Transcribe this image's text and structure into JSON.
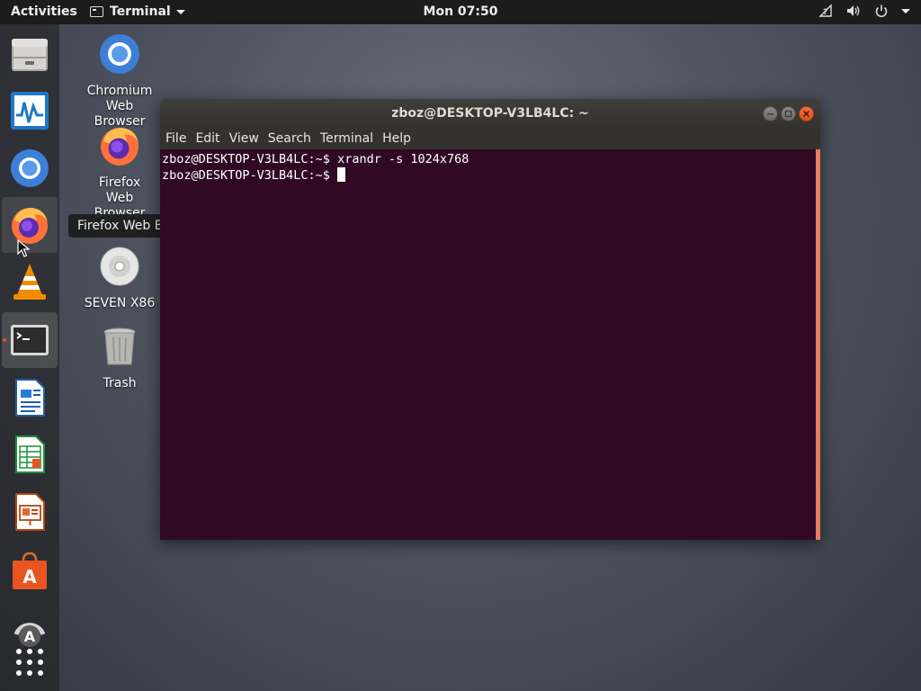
{
  "topbar": {
    "activities": "Activities",
    "app_menu": "Terminal",
    "clock": "Mon 07:50"
  },
  "dock": {
    "items": [
      {
        "name": "Files"
      },
      {
        "name": "System Monitor"
      },
      {
        "name": "Chromium Web Browser"
      },
      {
        "name": "Firefox Web Browser"
      },
      {
        "name": "VLC media player"
      },
      {
        "name": "Terminal",
        "running": true
      },
      {
        "name": "LibreOffice Writer"
      },
      {
        "name": "LibreOffice Calc"
      },
      {
        "name": "LibreOffice Impress"
      },
      {
        "name": "Ubuntu Software"
      },
      {
        "name": "Software Updater"
      },
      {
        "name": "Show Applications"
      }
    ]
  },
  "desktop": {
    "icons": [
      {
        "label": "Chromium\nWeb\nBrowser"
      },
      {
        "label": "Firefox\nWeb\nBrowser"
      },
      {
        "label": "SEVEN X86"
      },
      {
        "label": "Trash"
      }
    ]
  },
  "tooltip": "Firefox Web Browser",
  "terminal": {
    "title": "zboz@DESKTOP-V3LB4LC: ~",
    "menu": [
      "File",
      "Edit",
      "View",
      "Search",
      "Terminal",
      "Help"
    ],
    "lines": [
      "zboz@DESKTOP-V3LB4LC:~$ xrandr -s 1024x768",
      "zboz@DESKTOP-V3LB4LC:~$ "
    ],
    "background": "#300a24"
  },
  "colors": {
    "accent": "#e95420",
    "topbar": "#1c1c1c"
  }
}
